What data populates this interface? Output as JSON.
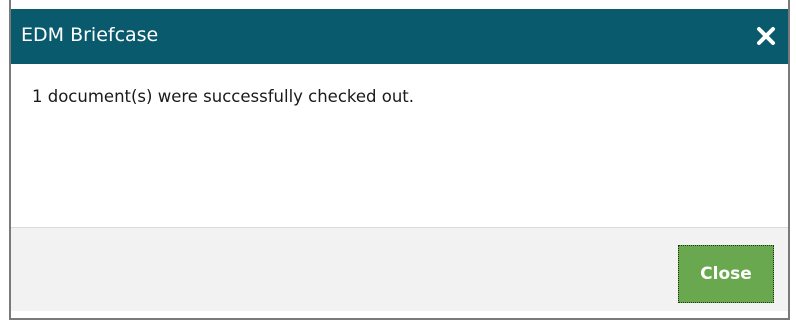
{
  "dialog": {
    "title": "EDM Briefcase",
    "message": "1 document(s) were successfully checked out.",
    "close_button_label": "Close",
    "close_icon": "close-icon"
  },
  "colors": {
    "titlebar": "#0a5a6d",
    "button": "#6aa84f",
    "footer": "#f2f2f2",
    "frame": "#7a7a7a"
  }
}
